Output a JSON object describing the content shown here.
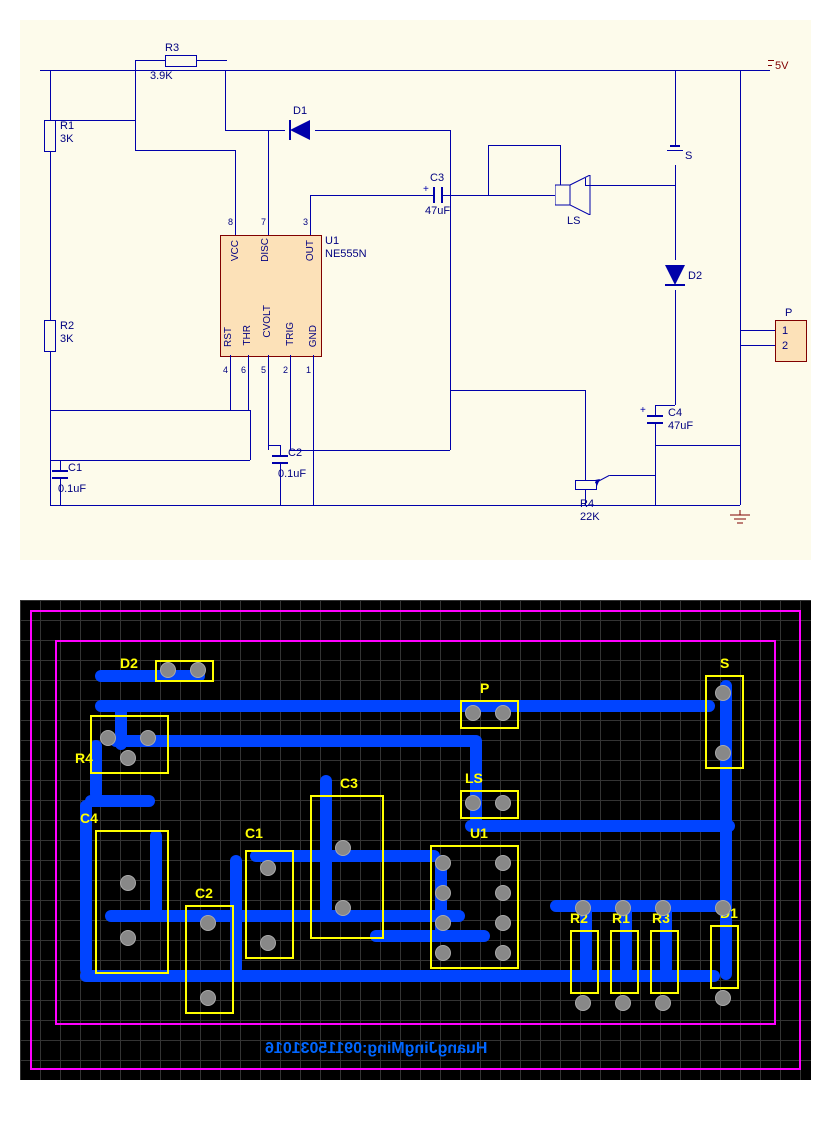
{
  "schematic": {
    "powerRail": "5V",
    "components": {
      "R1": {
        "ref": "R1",
        "value": "3K"
      },
      "R2": {
        "ref": "R2",
        "value": "3K"
      },
      "R3": {
        "ref": "R3",
        "value": "3.9K"
      },
      "R4": {
        "ref": "R4",
        "value": "22K"
      },
      "C1": {
        "ref": "C1",
        "value": "0.1uF"
      },
      "C2": {
        "ref": "C2",
        "value": "0.1uF"
      },
      "C3": {
        "ref": "C3",
        "value": "47uF"
      },
      "C4": {
        "ref": "C4",
        "value": "47uF"
      },
      "D1": {
        "ref": "D1"
      },
      "D2": {
        "ref": "D2"
      },
      "U1": {
        "ref": "U1",
        "value": "NE555N",
        "pins": {
          "p1": "GND",
          "p2": "TRIG",
          "p3": "OUT",
          "p4": "RST",
          "p5": "CVOLT",
          "p6": "THR",
          "p7": "DISC",
          "p8": "VCC"
        },
        "pinNumbers": {
          "n1": "1",
          "n2": "2",
          "n3": "3",
          "n4": "4",
          "n5": "5",
          "n6": "6",
          "n7": "7",
          "n8": "8"
        }
      },
      "LS": {
        "ref": "LS"
      },
      "S": {
        "ref": "S"
      },
      "P": {
        "ref": "P",
        "pin1": "1",
        "pin2": "2"
      }
    }
  },
  "pcb": {
    "refs": {
      "D1": "D1",
      "D2": "D2",
      "R1": "R1",
      "R2": "R2",
      "R3": "R3",
      "R4": "R4",
      "C1": "C1",
      "C2": "C2",
      "C3": "C3",
      "C4": "C4",
      "U1": "U1",
      "LS": "LS",
      "S": "S",
      "P": "P"
    },
    "text": "HuangJingMing:09115031016"
  }
}
